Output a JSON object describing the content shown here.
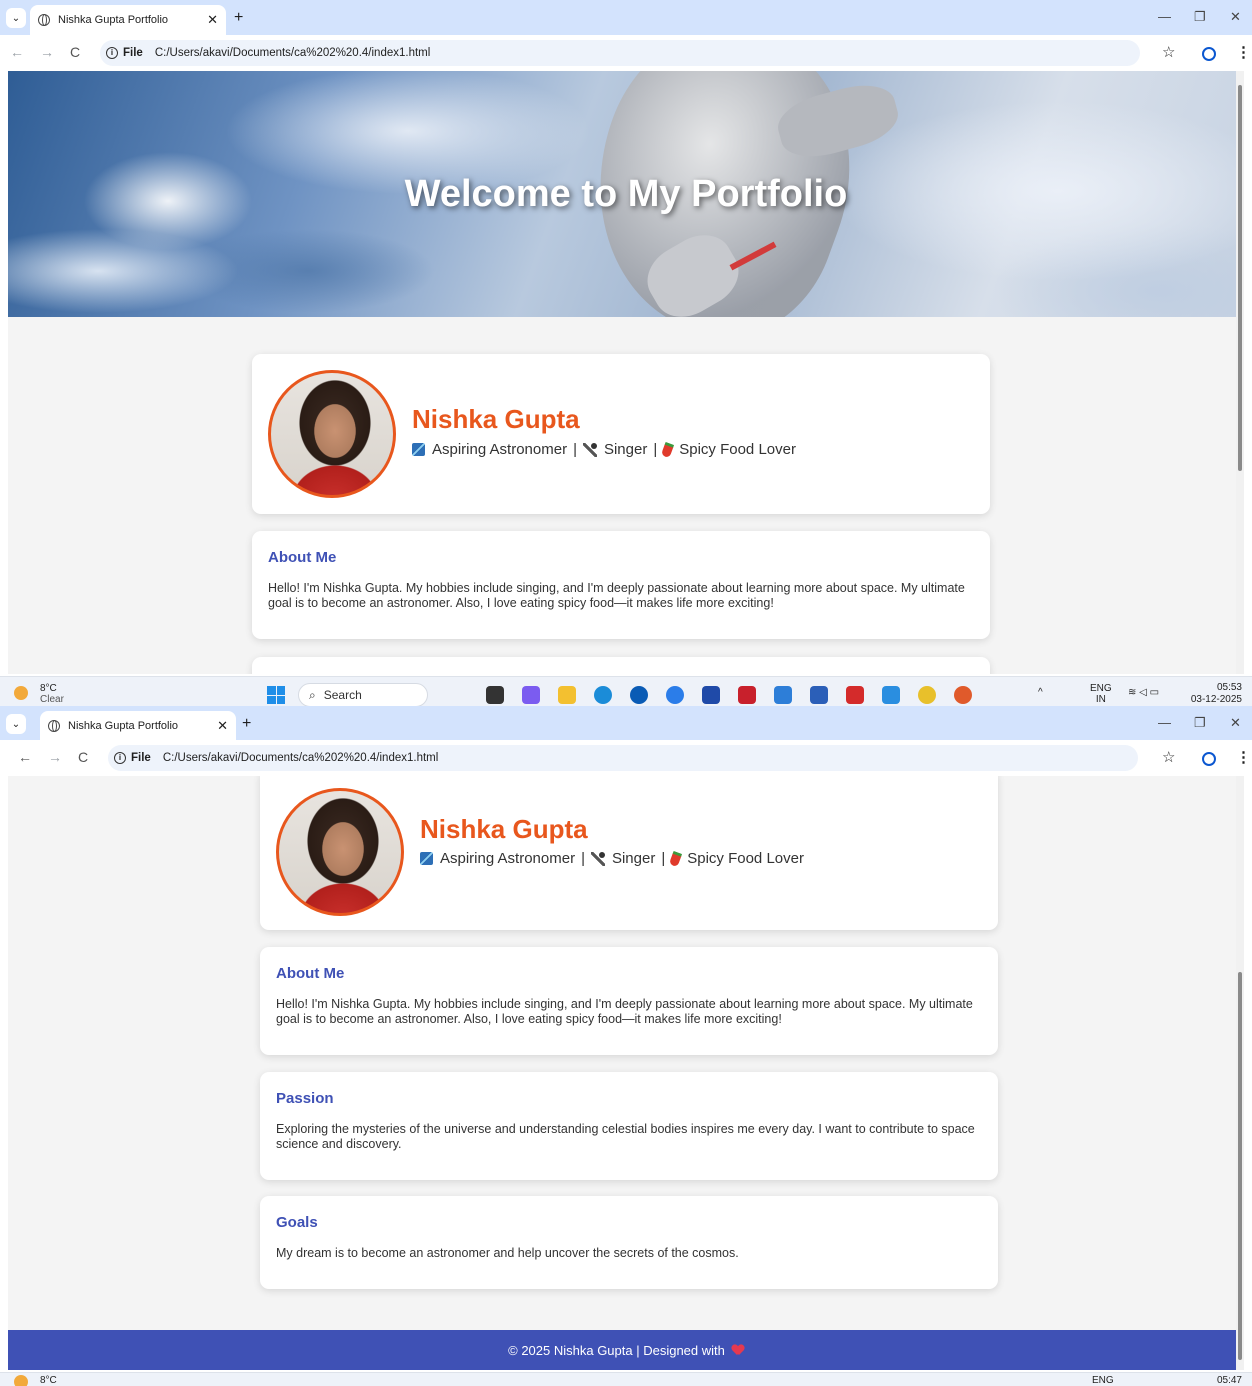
{
  "browser": {
    "tab_title": "Nishka Gupta Portfolio",
    "file_label": "File",
    "url": "C:/Users/akavi/Documents/ca%202%20.4/index1.html"
  },
  "hero": {
    "title": "Welcome to My Portfolio"
  },
  "profile": {
    "name": "Nishka Gupta",
    "roles": [
      "Aspiring Astronomer",
      "Singer",
      "Spicy Food Lover"
    ],
    "separator": "|"
  },
  "sections": {
    "about": {
      "title": "About Me",
      "text": "Hello! I'm Nishka Gupta. My hobbies include singing, and I'm deeply passionate about learning more about space. My ultimate goal is to become an astronomer. Also, I love eating spicy food—it makes life more exciting!"
    },
    "passion": {
      "title": "Passion",
      "text": "Exploring the mysteries of the universe and understanding celestial bodies inspires me every day. I want to contribute to space science and discovery."
    },
    "goals": {
      "title": "Goals",
      "text": "My dream is to become an astronomer and help uncover the secrets of the cosmos."
    }
  },
  "footer": {
    "text": "© 2025 Nishka Gupta | Designed with"
  },
  "taskbar": {
    "weather_temp": "8°C",
    "weather_desc": "Clear",
    "search_placeholder": "Search",
    "lang": "ENG",
    "region": "IN",
    "time_top": "05:53",
    "date_top": "03-12-2025",
    "time_bottom": "05:47"
  },
  "colors": {
    "accent": "#e8571d",
    "heading": "#3f51b5",
    "footer_bg": "#3f51b5"
  }
}
